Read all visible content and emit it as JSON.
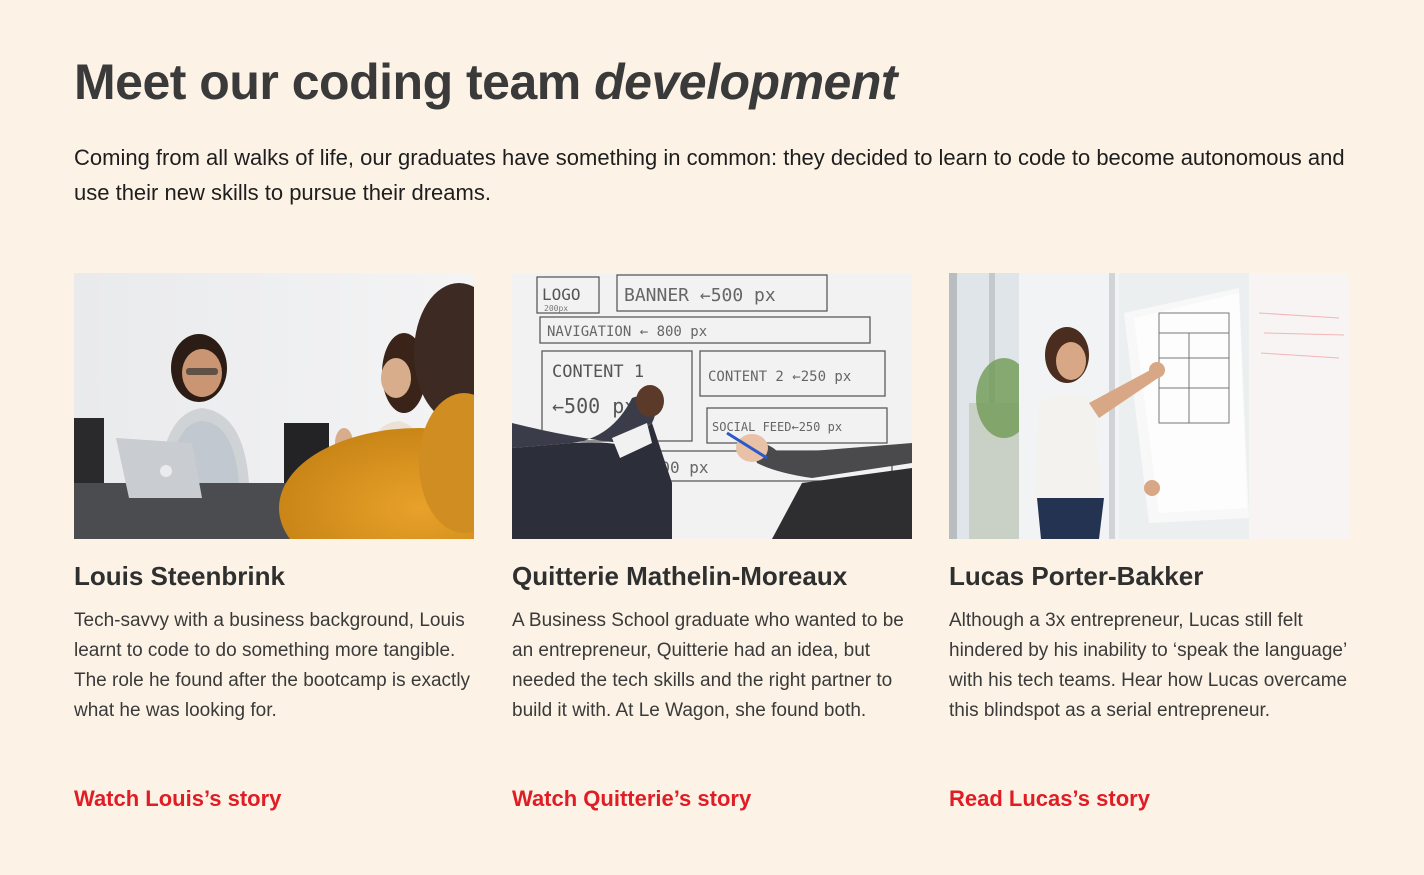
{
  "section": {
    "title_main": "Meet our coding team ",
    "title_emphasis": "development",
    "intro": "Coming from all walks of life, our graduates have something in common: they decided to learn to code to become autonomous and use their new skills to pursue their dreams."
  },
  "cards": [
    {
      "name": "Louis Steenbrink",
      "description": "Tech-savvy with a business background, Louis learnt to code to do something more tangible. The role he found after the bootcamp is exactly what he was looking for.",
      "link_label": "Watch Louis’s story",
      "photo": "meeting-laptop-photo"
    },
    {
      "name": "Quitterie Mathelin-Moreaux",
      "description": "A Business School graduate who wanted to be an entrepreneur, Quitterie had an idea, but needed the tech skills and the right partner to build it with. At Le Wagon, she found both.",
      "link_label": "Watch Quitterie’s story",
      "photo": "whiteboard-wireframe-photo",
      "whiteboard_text": {
        "logo": "LOGO",
        "logo_size": "200px",
        "banner": "BANNER ←500 px",
        "navigation": "NAVIGATION ← 800 px",
        "content1": "CONTENT 1",
        "content1_size": "←500 px",
        "content2": "CONTENT 2 ←250 px",
        "social": "SOCIAL FEED←250 px",
        "footer": "FOOTER ← 800 px"
      }
    },
    {
      "name": "Lucas Porter-Bakker",
      "description": "Although a 3x entrepreneur, Lucas still felt hindered by his inability to ‘speak the language’ with his tech teams. Hear how Lucas overcame this blindspot as a serial entrepreneur.",
      "link_label": "Read Lucas’s story",
      "photo": "flipchart-presentation-photo"
    }
  ],
  "colors": {
    "background": "#fcf3e6",
    "heading": "#3a3a3a",
    "link": "#e01c24"
  }
}
